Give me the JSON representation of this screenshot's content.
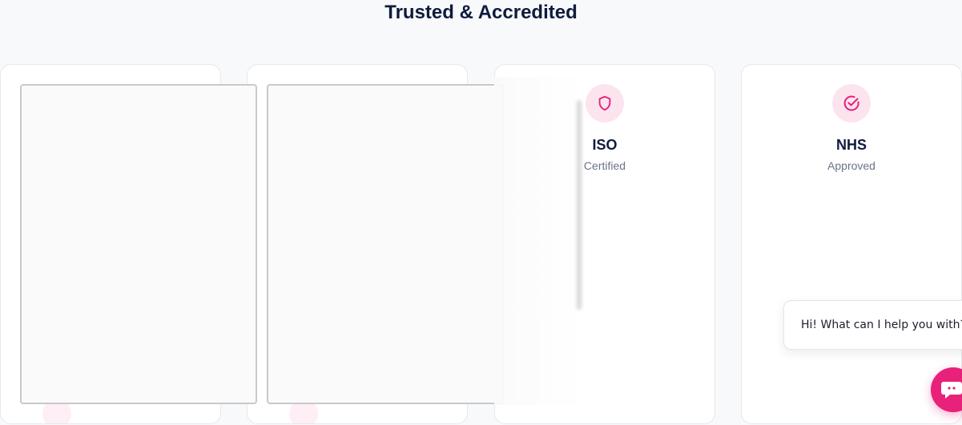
{
  "section": {
    "title": "Trusted & Accredited"
  },
  "cards": [
    {
      "title": "",
      "subtitle": ""
    },
    {
      "title": "",
      "subtitle": ""
    },
    {
      "title": "ISO",
      "subtitle": "Certified",
      "icon": "shield-icon"
    },
    {
      "title": "NHS",
      "subtitle": "Approved",
      "icon": "check-circle-icon"
    }
  ],
  "chat": {
    "greeting": "Hi! What can I help you with?",
    "launcher_icon": "chat-icon"
  },
  "colors": {
    "accent": "#e8217a",
    "accent_soft": "#fce4ef",
    "heading": "#0f1b3d",
    "muted": "#6b7389"
  }
}
